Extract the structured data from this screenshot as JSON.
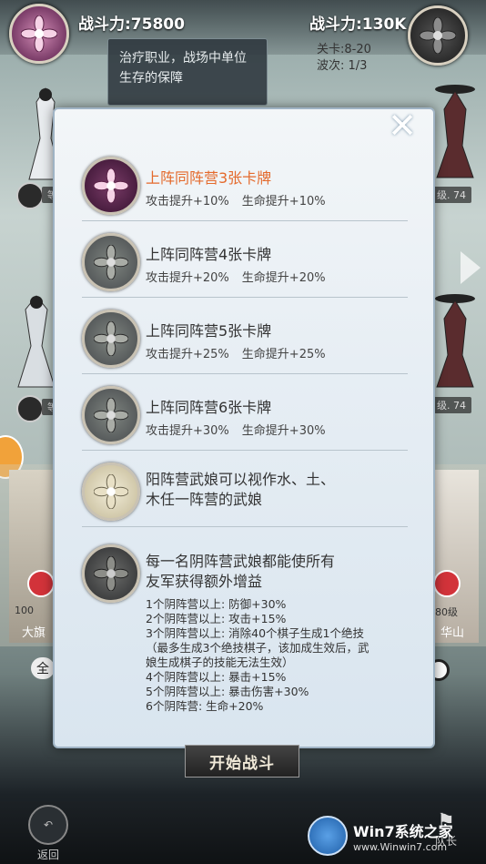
{
  "hud": {
    "left_power": "战斗力:75800",
    "right_power": "战斗力:130K",
    "tooltip": "治疗职业，战场中单位生存的保障",
    "stage": "关卡:8-20",
    "wave": "波次: 1/3"
  },
  "bg_tags": {
    "left_top": "等",
    "right_top": "级. 74",
    "left_mid": "等",
    "right_mid": "级. 74",
    "left_card_level": "100",
    "left_card_name": "大旗",
    "right_card_level": "80级",
    "right_card_name": "华山",
    "select_all": "全"
  },
  "modal": {
    "rows": [
      {
        "title": "上阵同阵营3张卡牌",
        "attack": "攻击提升+10%",
        "life": "生命提升+10%"
      },
      {
        "title": "上阵同阵营4张卡牌",
        "attack": "攻击提升+20%",
        "life": "生命提升+20%"
      },
      {
        "title": "上阵同阵营5张卡牌",
        "attack": "攻击提升+25%",
        "life": "生命提升+25%"
      },
      {
        "title": "上阵同阵营6张卡牌",
        "attack": "攻击提升+30%",
        "life": "生命提升+30%"
      }
    ],
    "yang": {
      "line1": "阳阵营武娘可以视作水、土、",
      "line2": "木任一阵营的武娘"
    },
    "yin": {
      "line1": "每一名阴阵营武娘都能使所有",
      "line2": "友军获得额外增益",
      "bonuses": [
        "1个阴阵营以上: 防御+30%",
        "2个阴阵营以上: 攻击+15%",
        "3个阴阵营以上: 消除40个棋子生成1个绝技",
        "（最多生成3个绝技棋子，该加成生效后，武",
        "娘生成棋子的技能无法生效）",
        "4个阴阵营以上: 暴击+15%",
        "5个阴阵营以上: 暴击伤害+30%",
        "6个阴阵营: 生命+20%"
      ]
    },
    "close_icon": "close-icon"
  },
  "footer": {
    "start_battle": "开始战斗",
    "back": "返回",
    "captain": "队长",
    "watermark_brand": "Win7系统之家",
    "watermark_url": "www.Winwin7.com"
  },
  "colors": {
    "highlight": "#e46a2c",
    "modal_bg": "#e7eef4"
  }
}
